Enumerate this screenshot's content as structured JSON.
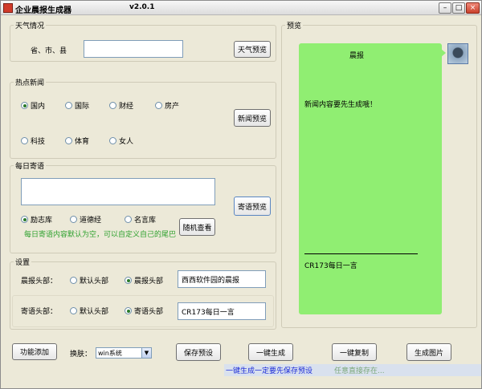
{
  "titlebar": {
    "title": "企业晨报生成器",
    "version": "v2.0.1",
    "min": "–",
    "max": "□",
    "close": "×"
  },
  "weather": {
    "group": "天气情况",
    "label": "省、市、县",
    "value": "",
    "preview_button": "天气预览"
  },
  "news": {
    "group": "热点新闻",
    "options": [
      {
        "label": "国内",
        "checked": true
      },
      {
        "label": "国际",
        "checked": false
      },
      {
        "label": "财经",
        "checked": false
      },
      {
        "label": "房产",
        "checked": false
      },
      {
        "label": "科技",
        "checked": false
      },
      {
        "label": "体育",
        "checked": false
      },
      {
        "label": "女人",
        "checked": false
      }
    ],
    "preview_button": "新闻预览"
  },
  "daily": {
    "group": "每日寄语",
    "value": "",
    "options": [
      {
        "label": "励志库",
        "checked": true
      },
      {
        "label": "道德经",
        "checked": false
      },
      {
        "label": "名言库",
        "checked": false
      }
    ],
    "random_button": "随机查看",
    "preview_button": "寄语预览",
    "hint": "每日寄语内容默认为空，可以自定义自己的尾巴"
  },
  "settings": {
    "group": "设置",
    "header_label": "晨报头部：",
    "header_default": "默认头部",
    "header_custom": "晨报头部",
    "header_value": "西西软件园的晨报",
    "footer_label": "寄语头部：",
    "footer_default": "默认头部",
    "footer_custom": "寄语头部",
    "footer_value": "CR173每日一言"
  },
  "preview": {
    "group": "预览",
    "header": "晨报",
    "content": "新闻内容要先生成哦！",
    "footer": "CR173每日一言"
  },
  "bottom": {
    "add_feature": "功能添加",
    "skin_label": "换肤：",
    "skin_value": "win系统",
    "save_preset": "保存预设",
    "generate": "一键生成",
    "copy": "一键复制",
    "make_image": "生成图片",
    "status": "一键生成一定要先保存预设",
    "status2": "任意直接存在..."
  }
}
